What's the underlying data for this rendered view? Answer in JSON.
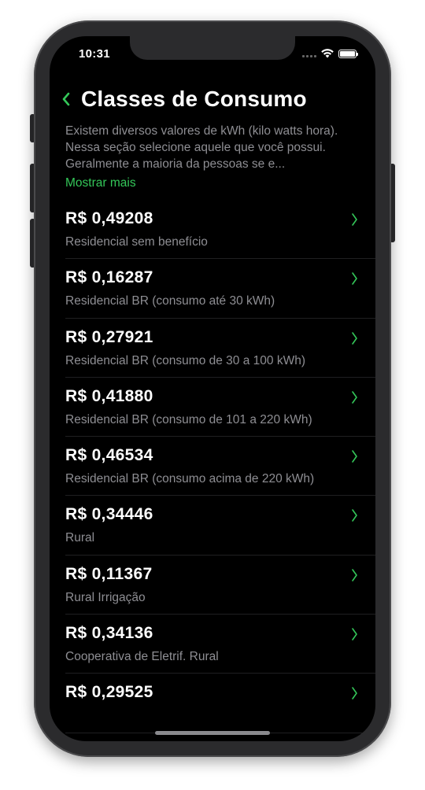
{
  "status_bar": {
    "time": "10:31"
  },
  "nav": {
    "title": "Classes de Consumo"
  },
  "description": "Existem diversos valores de kWh (kilo watts hora). Nessa seção selecione aquele que você possui. Geralmente a maioria da pessoas se e...",
  "show_more_label": "Mostrar mais",
  "colors": {
    "accent": "#34c759",
    "background": "#000000",
    "secondary_text": "#8e8e93"
  },
  "items": [
    {
      "price": "R$ 0,49208",
      "label": "Residencial sem benefício"
    },
    {
      "price": "R$ 0,16287",
      "label": "Residencial BR (consumo até 30 kWh)"
    },
    {
      "price": "R$ 0,27921",
      "label": "Residencial BR (consumo de 30 a 100 kWh)"
    },
    {
      "price": "R$ 0,41880",
      "label": "Residencial BR (consumo de 101 a 220 kWh)"
    },
    {
      "price": "R$ 0,46534",
      "label": "Residencial BR (consumo acima de 220 kWh)"
    },
    {
      "price": "R$ 0,34446",
      "label": "Rural"
    },
    {
      "price": "R$ 0,11367",
      "label": "Rural Irrigação"
    },
    {
      "price": "R$ 0,34136",
      "label": "Cooperativa de Eletrif. Rural"
    },
    {
      "price": "R$ 0,29525",
      "label": ""
    }
  ]
}
